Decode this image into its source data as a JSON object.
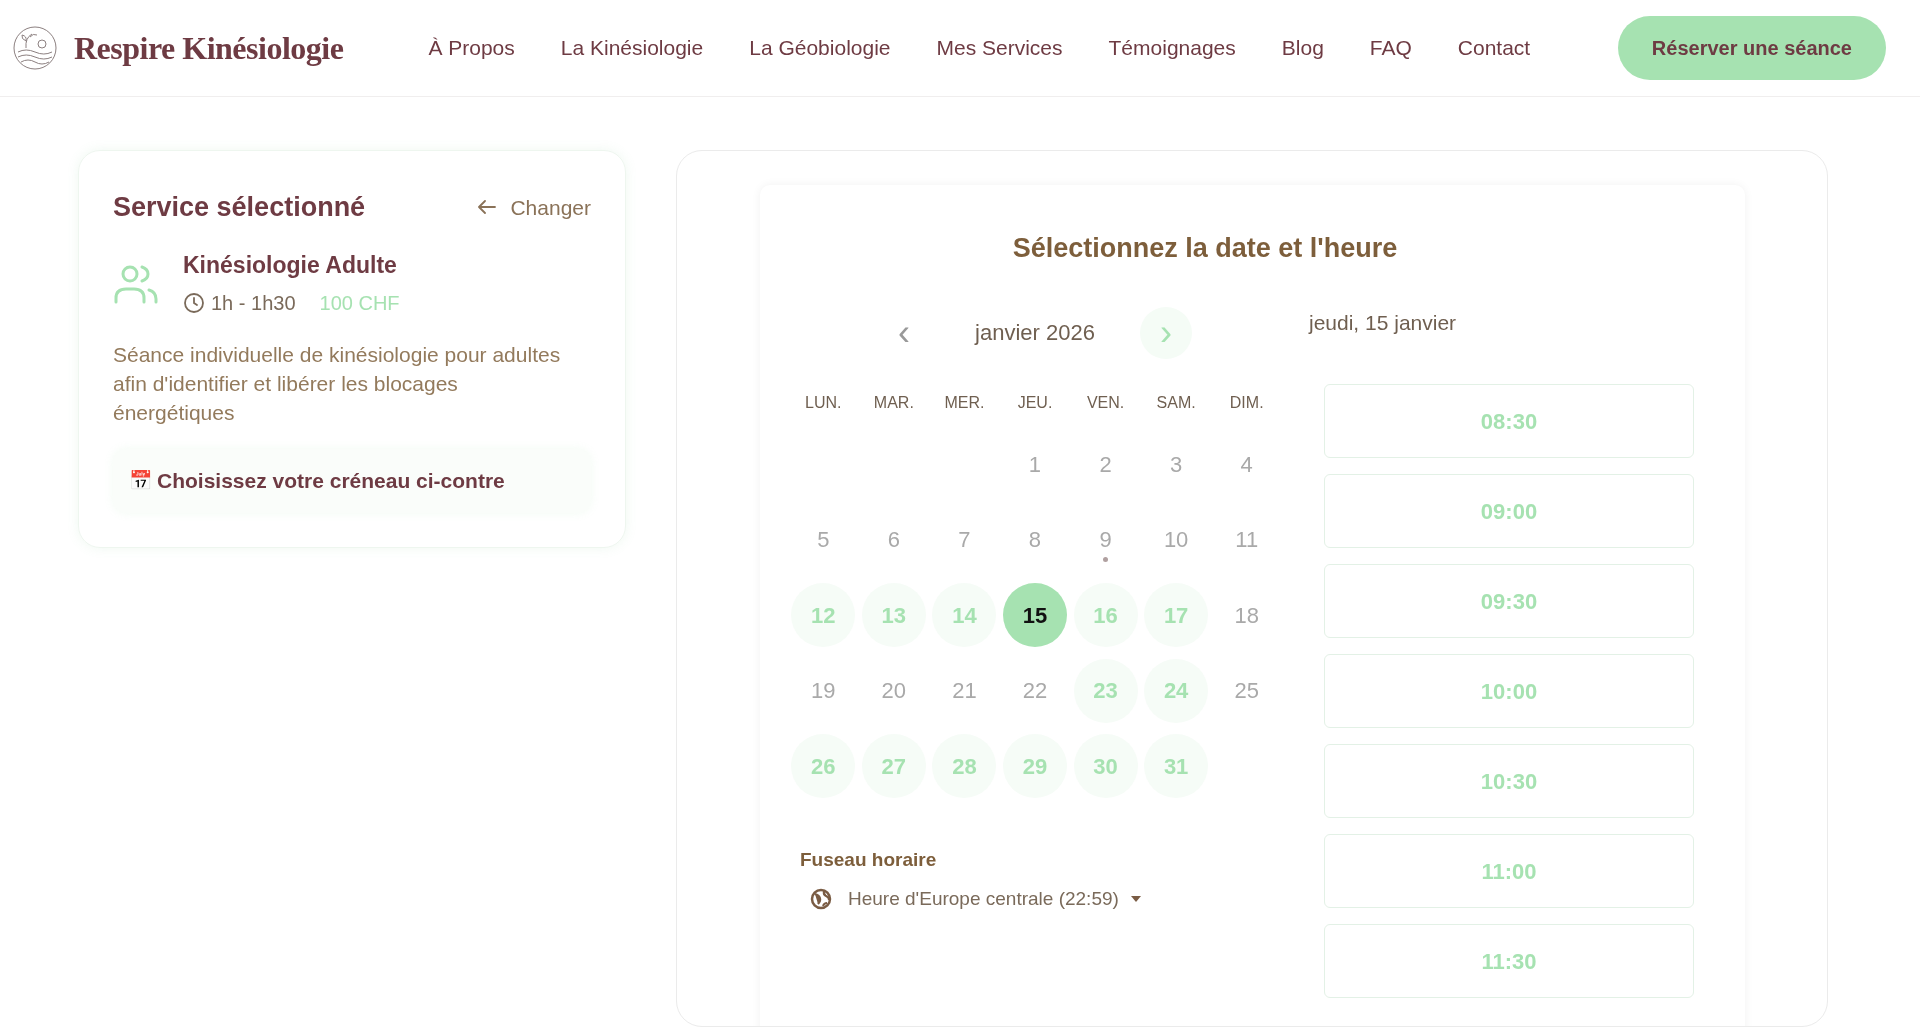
{
  "header": {
    "brand": "Respire Kinésiologie",
    "nav": [
      "À Propos",
      "La Kinésiologie",
      "La Géobiologie",
      "Mes Services",
      "Témoignages",
      "Blog",
      "FAQ",
      "Contact"
    ],
    "cta": "Réserver une séance"
  },
  "service": {
    "title": "Service sélectionné",
    "change": "Changer",
    "name": "Kinésiologie Adulte",
    "duration": "1h - 1h30",
    "price": "100 CHF",
    "description": "Séance individuelle de kinésiologie pour adultes afin d'identifier et libérer les blocages énergétiques",
    "hint_emoji": "📅",
    "hint": "Choisissez votre créneau ci-contre"
  },
  "calendar": {
    "title": "Sélectionnez la date et l'heure",
    "prev": "‹",
    "month": "janvier 2026",
    "next": "›",
    "weekdays": [
      "LUN.",
      "MAR.",
      "MER.",
      "JEU.",
      "VEN.",
      "SAM.",
      "DIM."
    ],
    "weeks": [
      [
        {
          "kind": "blank"
        },
        {
          "kind": "blank"
        },
        {
          "kind": "blank"
        },
        {
          "kind": "day",
          "label": "1",
          "available": false,
          "selected": false,
          "today": false
        },
        {
          "kind": "day",
          "label": "2",
          "available": false,
          "selected": false,
          "today": false
        },
        {
          "kind": "day",
          "label": "3",
          "available": false,
          "selected": false,
          "today": false
        },
        {
          "kind": "day",
          "label": "4",
          "available": false,
          "selected": false,
          "today": false
        }
      ],
      [
        {
          "kind": "day",
          "label": "5",
          "available": false,
          "selected": false,
          "today": false
        },
        {
          "kind": "day",
          "label": "6",
          "available": false,
          "selected": false,
          "today": false
        },
        {
          "kind": "day",
          "label": "7",
          "available": false,
          "selected": false,
          "today": false
        },
        {
          "kind": "day",
          "label": "8",
          "available": false,
          "selected": false,
          "today": false
        },
        {
          "kind": "day",
          "label": "9",
          "available": false,
          "selected": false,
          "today": true
        },
        {
          "kind": "day",
          "label": "10",
          "available": false,
          "selected": false,
          "today": false
        },
        {
          "kind": "day",
          "label": "11",
          "available": false,
          "selected": false,
          "today": false
        }
      ],
      [
        {
          "kind": "day",
          "label": "12",
          "available": true,
          "selected": false,
          "today": false
        },
        {
          "kind": "day",
          "label": "13",
          "available": true,
          "selected": false,
          "today": false
        },
        {
          "kind": "day",
          "label": "14",
          "available": true,
          "selected": false,
          "today": false
        },
        {
          "kind": "day",
          "label": "15",
          "available": true,
          "selected": true,
          "today": false
        },
        {
          "kind": "day",
          "label": "16",
          "available": true,
          "selected": false,
          "today": false
        },
        {
          "kind": "day",
          "label": "17",
          "available": true,
          "selected": false,
          "today": false
        },
        {
          "kind": "day",
          "label": "18",
          "available": false,
          "selected": false,
          "today": false
        }
      ],
      [
        {
          "kind": "day",
          "label": "19",
          "available": false,
          "selected": false,
          "today": false
        },
        {
          "kind": "day",
          "label": "20",
          "available": false,
          "selected": false,
          "today": false
        },
        {
          "kind": "day",
          "label": "21",
          "available": false,
          "selected": false,
          "today": false
        },
        {
          "kind": "day",
          "label": "22",
          "available": false,
          "selected": false,
          "today": false
        },
        {
          "kind": "day",
          "label": "23",
          "available": true,
          "selected": false,
          "today": false
        },
        {
          "kind": "day",
          "label": "24",
          "available": true,
          "selected": false,
          "today": false
        },
        {
          "kind": "day",
          "label": "25",
          "available": false,
          "selected": false,
          "today": false
        }
      ],
      [
        {
          "kind": "day",
          "label": "26",
          "available": true,
          "selected": false,
          "today": false
        },
        {
          "kind": "day",
          "label": "27",
          "available": true,
          "selected": false,
          "today": false
        },
        {
          "kind": "day",
          "label": "28",
          "available": true,
          "selected": false,
          "today": false
        },
        {
          "kind": "day",
          "label": "29",
          "available": true,
          "selected": false,
          "today": false
        },
        {
          "kind": "day",
          "label": "30",
          "available": true,
          "selected": false,
          "today": false
        },
        {
          "kind": "day",
          "label": "31",
          "available": true,
          "selected": false,
          "today": false
        },
        {
          "kind": "blank"
        }
      ]
    ],
    "timezone_label": "Fuseau horaire",
    "timezone": "Heure d'Europe centrale (22:59)",
    "selected_date": "jeudi, 15 janvier",
    "slots": [
      "08:30",
      "09:00",
      "09:30",
      "10:00",
      "10:30",
      "11:00",
      "11:30"
    ]
  }
}
